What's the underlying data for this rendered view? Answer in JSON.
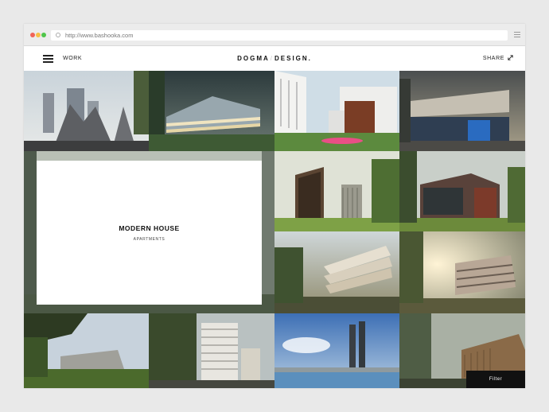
{
  "browser": {
    "url": "http://www.bashooka.com"
  },
  "header": {
    "work_label": "WORK",
    "logo_left": "DOGMA",
    "logo_right": "DESIGN.",
    "share_label": "SHARE"
  },
  "feature": {
    "title": "MODERN HOUSE",
    "subtitle": "APARTMENTS"
  },
  "filter_label": "Filter",
  "colors": {
    "dot_red": "#f06459",
    "dot_yellow": "#f7c046",
    "dot_green": "#4fc54a",
    "filter_bg": "#111111"
  }
}
